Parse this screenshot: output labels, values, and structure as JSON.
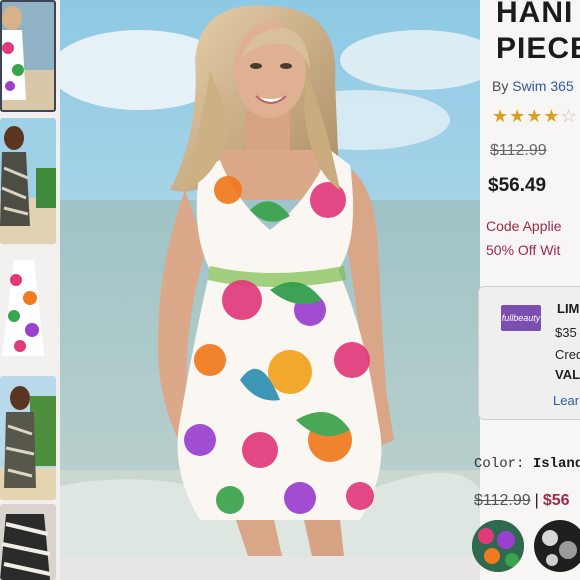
{
  "product": {
    "title_line1": "HANI",
    "title_line2": "PIECE",
    "by_prefix": "By",
    "brand": "Swim 365",
    "stars_full": "★★★★",
    "stars_empty": "☆",
    "rating_stars": 4,
    "original_price": "$112.99",
    "sale_price": "$56.49",
    "promo_line1": "Code Applie",
    "promo_line2": "50% Off Wit"
  },
  "promo_card": {
    "logo_text": "fullbeauty",
    "title": "LIM",
    "line1": "$35",
    "line2": "Cred",
    "line3": "VAL",
    "link": "Lear"
  },
  "color_selector": {
    "label": "Color:",
    "value": "Island I",
    "original_price": "$112.99",
    "separator": "|",
    "sale_price": "$56",
    "swatches": [
      "island-floral",
      "black-floral"
    ]
  },
  "colors": {
    "promo_red": "#a0294a",
    "link_blue": "#2e5b9e",
    "star_gold": "#d8a21e"
  }
}
